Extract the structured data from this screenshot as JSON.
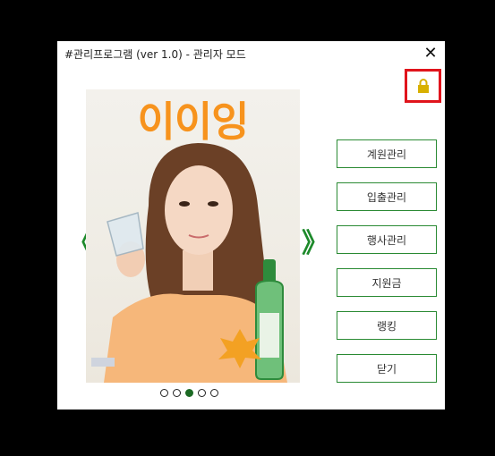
{
  "window": {
    "title": "#관리프로그램 (ver 1.0) - 관리자 모드",
    "close_label": "✕"
  },
  "slideshow": {
    "poster_title": "이이잉",
    "prev_label": "《",
    "next_label": "》",
    "dot_count": 5,
    "active_index": 2
  },
  "menu": {
    "items": [
      {
        "label": "계원관리"
      },
      {
        "label": "입출관리"
      },
      {
        "label": "행사관리"
      },
      {
        "label": "지원금"
      },
      {
        "label": "랭킹"
      },
      {
        "label": "닫기"
      }
    ]
  },
  "colors": {
    "accent_green": "#2a8a33",
    "lock_highlight": "#e0141c",
    "lock_icon": "#d8b000",
    "poster_text": "#f7931d"
  },
  "icons": {
    "lock": "lock-icon"
  }
}
